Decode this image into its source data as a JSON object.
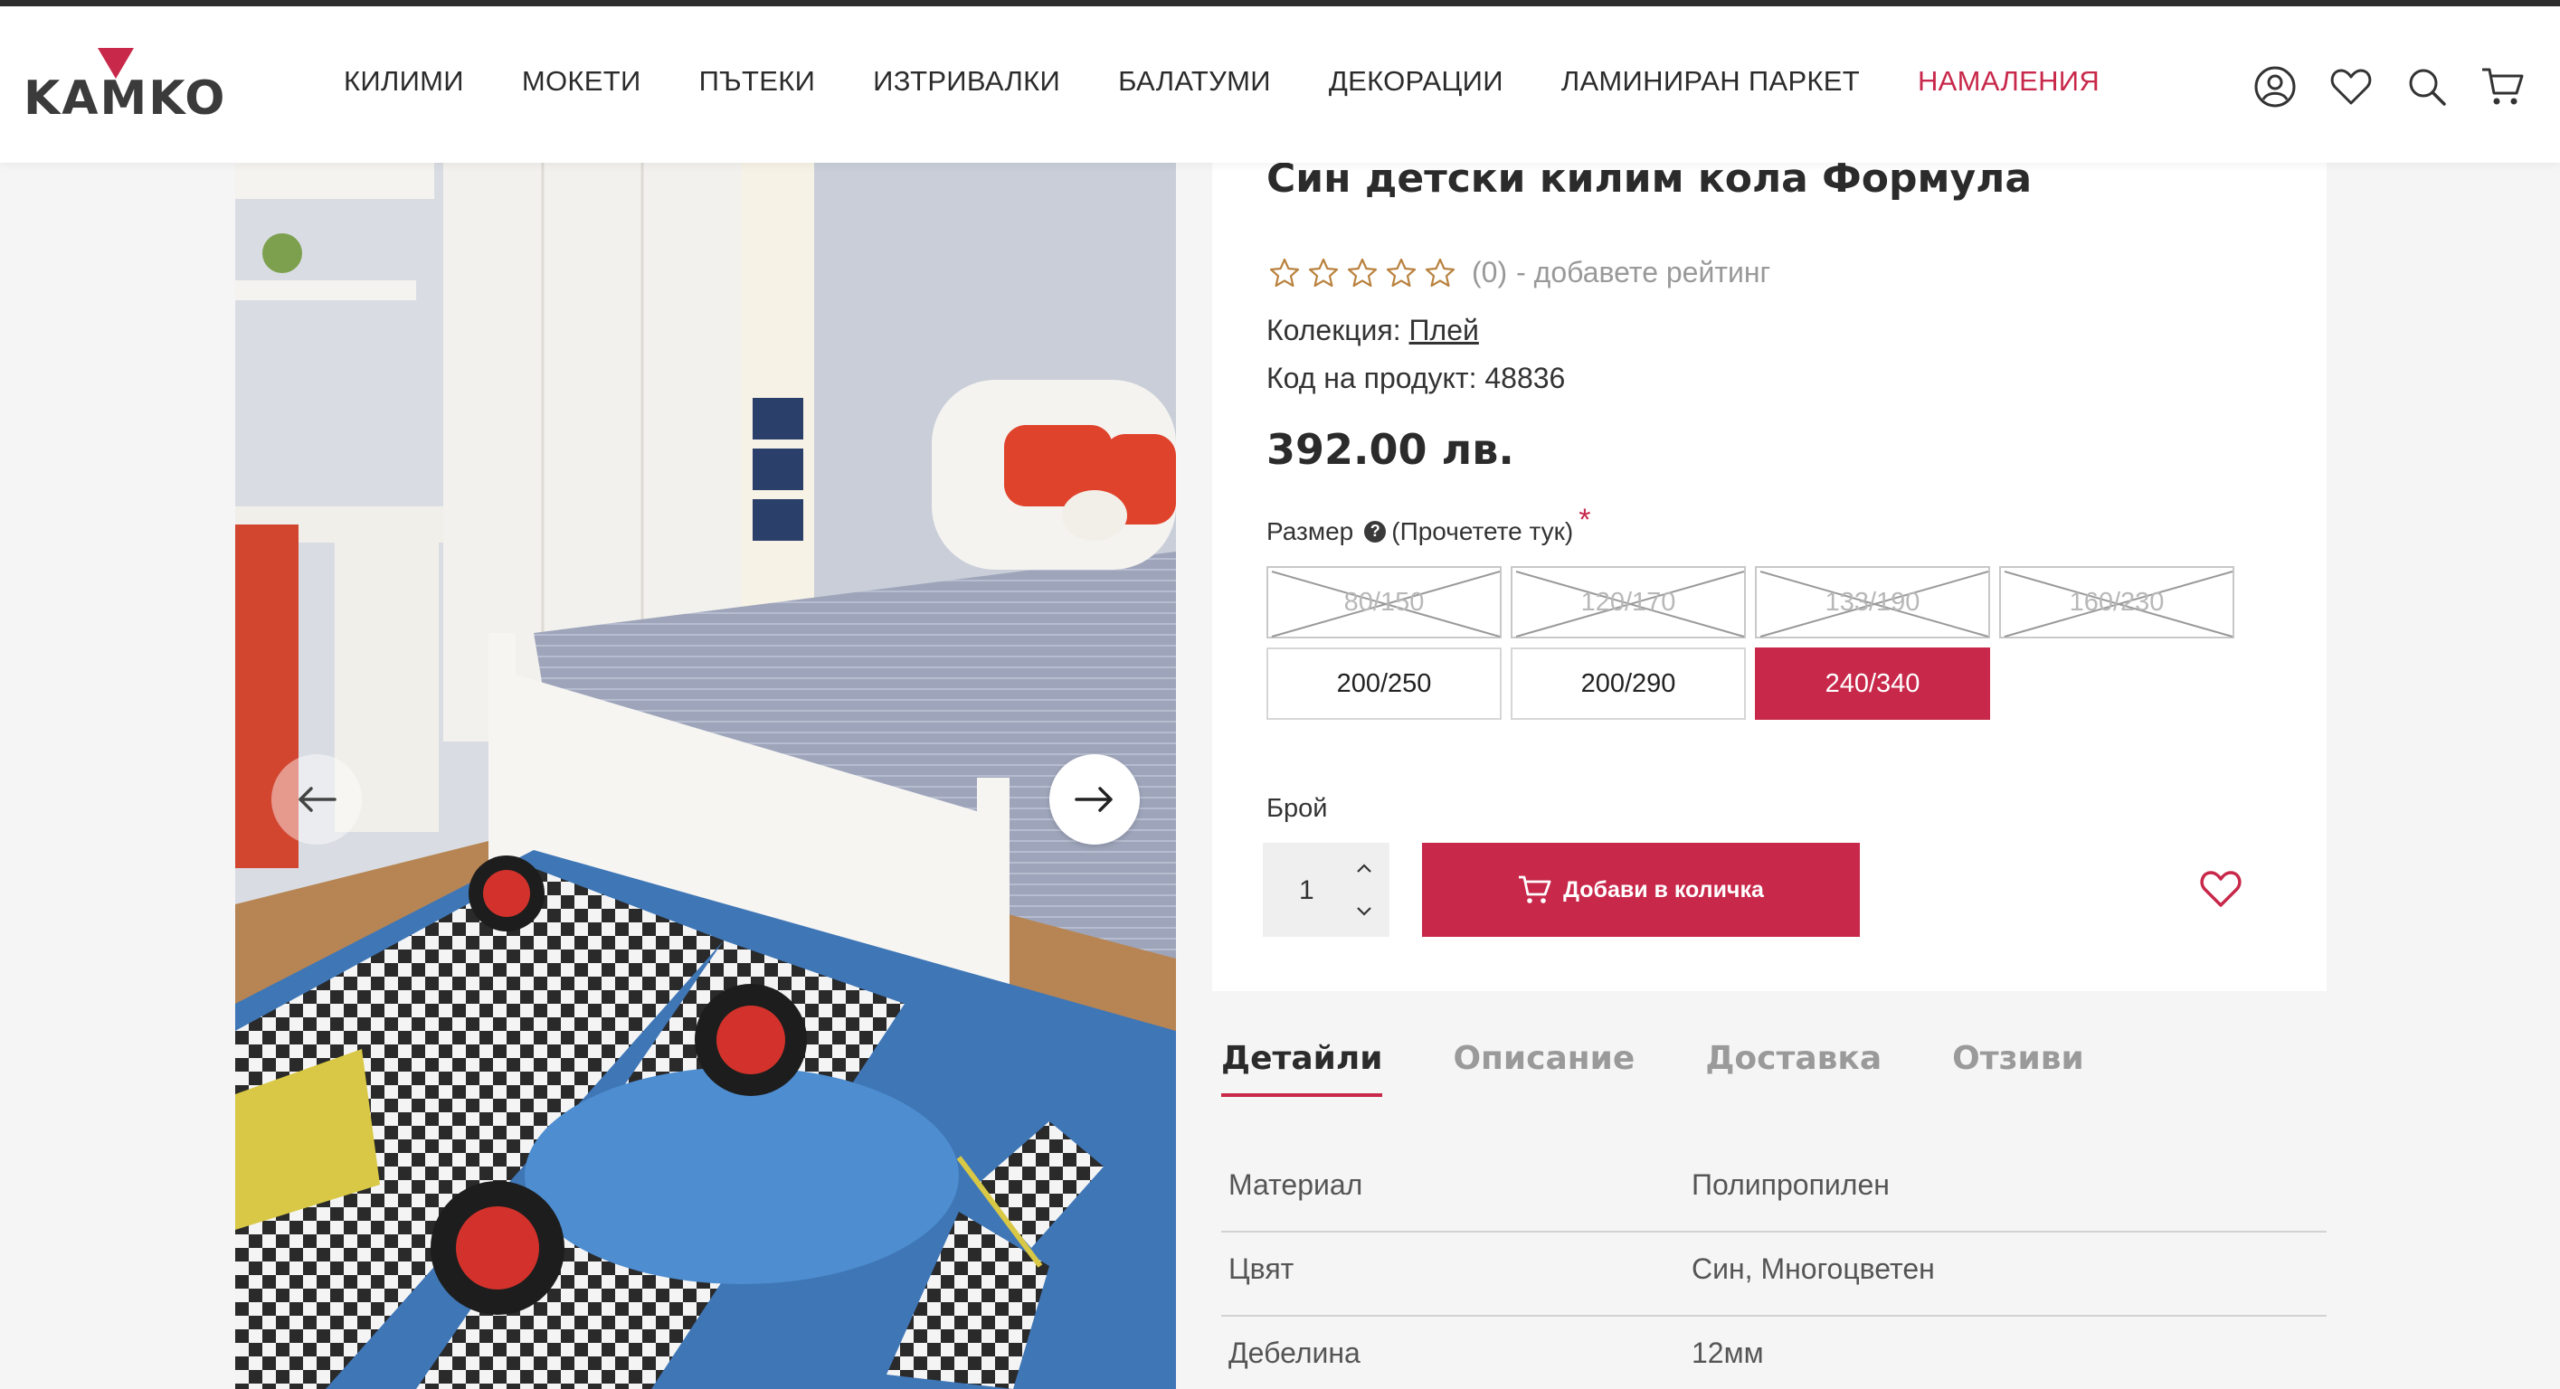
{
  "brand": {
    "logo_text": "KAMKO",
    "accent_color": "#c8284a"
  },
  "nav": {
    "items": [
      {
        "label": "КИЛИМИ"
      },
      {
        "label": "МОКЕТИ"
      },
      {
        "label": "ПЪТЕКИ"
      },
      {
        "label": "ИЗТРИВАЛКИ"
      },
      {
        "label": "БАЛАТУМИ"
      },
      {
        "label": "ДЕКОРАЦИИ"
      },
      {
        "label": "ЛАМИНИРАН ПАРКЕТ"
      },
      {
        "label": "НАМАЛЕНИЯ"
      }
    ]
  },
  "header_icons": [
    "account-icon",
    "heart-icon",
    "search-icon",
    "cart-icon"
  ],
  "gallery": {
    "image": "bedroom-with-race-car-rug",
    "prev_icon": "arrow-left-icon",
    "next_icon": "arrow-right-icon"
  },
  "product": {
    "title": "Син детски килим кола Формула",
    "rating_count": "(0)",
    "rating_link": "- добавете рейтинг",
    "stars_filled": 0,
    "stars_total": 5,
    "collection_label": "Колекция:",
    "collection_value": "Плей",
    "code_text": "Код на продукт: 48836",
    "price": "392.00 лв.",
    "size_label": "Размер",
    "size_help": "(Прочетете тук)",
    "required_mark": "*",
    "sizes": [
      {
        "label": "80/150",
        "state": "disabled"
      },
      {
        "label": "120/170",
        "state": "disabled"
      },
      {
        "label": "133/190",
        "state": "disabled"
      },
      {
        "label": "160/230",
        "state": "disabled"
      },
      {
        "label": "200/250",
        "state": "available"
      },
      {
        "label": "200/290",
        "state": "available"
      },
      {
        "label": "240/340",
        "state": "selected"
      }
    ],
    "quantity_label": "Брой",
    "quantity": "1",
    "add_to_cart": "Добави в количка"
  },
  "tabs": [
    {
      "label": "Детайли",
      "active": true
    },
    {
      "label": "Описание",
      "active": false
    },
    {
      "label": "Доставка",
      "active": false
    },
    {
      "label": "Отзиви",
      "active": false
    }
  ],
  "specs": [
    {
      "key": "Материал",
      "value": "Полипропилен"
    },
    {
      "key": "Цвят",
      "value": "Син, Многоцветен"
    },
    {
      "key": "Дебелина",
      "value": "12мм"
    }
  ]
}
